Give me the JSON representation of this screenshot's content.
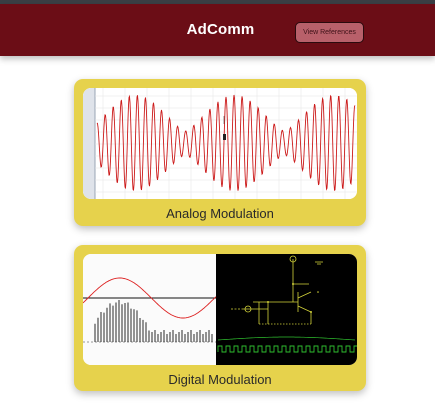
{
  "header": {
    "title": "AdComm",
    "references_button": "View References"
  },
  "cards": [
    {
      "label": "Analog Modulation",
      "image": "am-waveform-plot"
    },
    {
      "label": "Digital Modulation",
      "image": "digital-modulation-scope-and-circuit"
    }
  ],
  "colors": {
    "header_bg": "#6b0d16",
    "card_bg": "#e6d24c",
    "waveform": "#cc1a1a",
    "circuit_line": "#d4d43a",
    "scope_trace": "#2fbf2f"
  }
}
